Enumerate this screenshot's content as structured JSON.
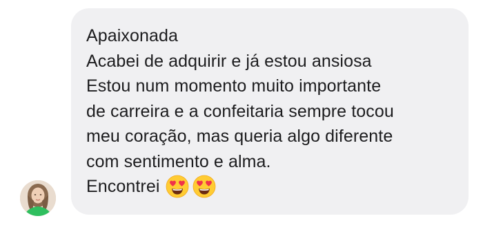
{
  "message": {
    "lines": [
      "Apaixonada",
      "Acabei de adquirir e já estou ansiosa",
      "Estou num momento muito importante",
      "de carreira e a confeitaria sempre tocou",
      "meu coração, mas queria algo diferente",
      "com sentimento e alma.",
      "Encontrei"
    ],
    "emojis": [
      "heart-eyes-emoji",
      "heart-eyes-emoji"
    ]
  },
  "colors": {
    "bubble_background": "#f0f0f2",
    "text": "#1c1c1e"
  }
}
